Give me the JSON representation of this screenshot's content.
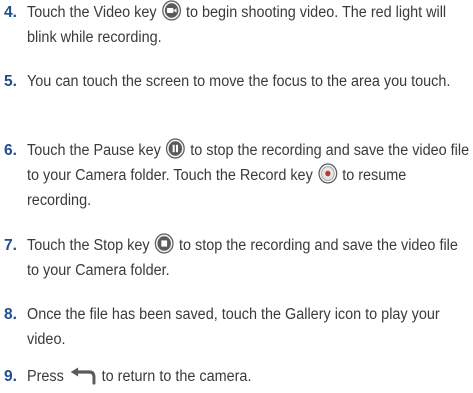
{
  "steps": [
    {
      "number": "4.",
      "parts": [
        "Touch the Video key ",
        " to begin shooting video. The red light will blink while recording."
      ],
      "icon": "video-camera-icon"
    },
    {
      "number": "5.",
      "parts": [
        "You can touch the screen to move the focus to the area you touch."
      ]
    },
    {
      "number": "6.",
      "parts": [
        "Touch the Pause key ",
        " to stop the recording and save the video file to your Camera folder. Touch the Record key ",
        " to resume recording."
      ],
      "icons": [
        "pause-icon",
        "record-icon"
      ]
    },
    {
      "number": "7.",
      "parts": [
        "Touch the Stop key ",
        " to stop the recording and save the video file to your Camera folder."
      ],
      "icon": "stop-icon"
    },
    {
      "number": "8.",
      "parts": [
        "Once the file has been saved, touch the Gallery icon to play your video."
      ]
    },
    {
      "number": "9.",
      "parts": [
        "Press ",
        " to return to the camera."
      ],
      "icon": "back-arrow-icon"
    }
  ],
  "colors": {
    "number": "#1f4e8c",
    "text": "#3a3a3a",
    "icon_fill": "#5a5a5a"
  }
}
